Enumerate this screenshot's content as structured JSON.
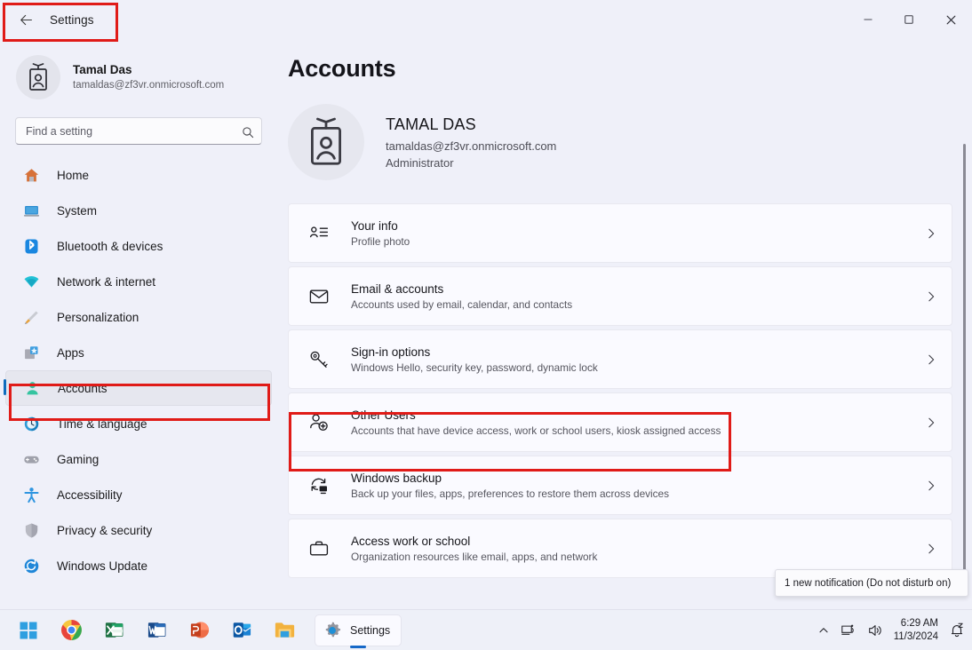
{
  "window": {
    "title": "Settings",
    "back_icon": "back-arrow-icon",
    "minimize_label": "–",
    "maximize_label": "❐",
    "close_label": "✕"
  },
  "sidebar": {
    "profile": {
      "name": "Tamal Das",
      "email": "tamaldas@zf3vr.onmicrosoft.com"
    },
    "search": {
      "placeholder": "Find a setting",
      "value": "",
      "icon": "search-icon"
    },
    "items": [
      {
        "label": "Home",
        "icon": "home-icon",
        "selected": false
      },
      {
        "label": "System",
        "icon": "system-icon",
        "selected": false
      },
      {
        "label": "Bluetooth & devices",
        "icon": "bluetooth-icon",
        "selected": false
      },
      {
        "label": "Network & internet",
        "icon": "network-icon",
        "selected": false
      },
      {
        "label": "Personalization",
        "icon": "brush-icon",
        "selected": false
      },
      {
        "label": "Apps",
        "icon": "apps-icon",
        "selected": false
      },
      {
        "label": "Accounts",
        "icon": "accounts-icon",
        "selected": true
      },
      {
        "label": "Time & language",
        "icon": "clock-icon",
        "selected": false
      },
      {
        "label": "Gaming",
        "icon": "gamepad-icon",
        "selected": false
      },
      {
        "label": "Accessibility",
        "icon": "accessibility-icon",
        "selected": false
      },
      {
        "label": "Privacy & security",
        "icon": "shield-icon",
        "selected": false
      },
      {
        "label": "Windows Update",
        "icon": "update-icon",
        "selected": false
      }
    ]
  },
  "main": {
    "page_title": "Accounts",
    "hero": {
      "name": "TAMAL DAS",
      "email": "tamaldas@zf3vr.onmicrosoft.com",
      "role": "Administrator",
      "avatar_icon": "account-card-icon"
    },
    "cards": [
      {
        "title": "Your info",
        "subtitle": "Profile photo",
        "icon": "your-info-icon",
        "chevron": "chevron-right-icon"
      },
      {
        "title": "Email & accounts",
        "subtitle": "Accounts used by email, calendar, and contacts",
        "icon": "envelope-icon",
        "chevron": "chevron-right-icon"
      },
      {
        "title": "Sign-in options",
        "subtitle": "Windows Hello, security key, password, dynamic lock",
        "icon": "key-icon",
        "chevron": "chevron-right-icon"
      },
      {
        "title": "Other Users",
        "subtitle": "Accounts that have device access, work or school users, kiosk assigned access",
        "icon": "add-user-icon",
        "chevron": "chevron-right-icon"
      },
      {
        "title": "Windows backup",
        "subtitle": "Back up your files, apps, preferences to restore them across devices",
        "icon": "backup-icon",
        "chevron": "chevron-right-icon"
      },
      {
        "title": "Access work or school",
        "subtitle": "Organization resources like email, apps, and network",
        "icon": "briefcase-icon",
        "chevron": "chevron-right-icon"
      }
    ]
  },
  "tooltip": {
    "text": "1 new notification (Do not disturb on)"
  },
  "taskbar": {
    "buttons": [
      {
        "name": "start-button",
        "icon": "windows-logo-icon"
      },
      {
        "name": "chrome-button",
        "icon": "chrome-icon"
      },
      {
        "name": "excel-button",
        "icon": "excel-icon"
      },
      {
        "name": "word-button",
        "icon": "word-icon"
      },
      {
        "name": "powerpoint-button",
        "icon": "powerpoint-icon"
      },
      {
        "name": "outlook-button",
        "icon": "outlook-icon"
      },
      {
        "name": "file-explorer-button",
        "icon": "folder-icon"
      }
    ],
    "active_app": {
      "label": "Settings",
      "icon": "settings-gear-icon"
    },
    "tray": {
      "overflow_icon": "chevron-up-icon",
      "network_icon": "network-tray-icon",
      "volume_icon": "speaker-icon",
      "time": "6:29 AM",
      "date": "11/3/2024",
      "notification_icon": "bell-dnd-icon"
    }
  },
  "annotations": {
    "accent_color": "#e01b18",
    "boxes": [
      "settings-title",
      "sidebar-accounts",
      "other-users-card"
    ]
  }
}
